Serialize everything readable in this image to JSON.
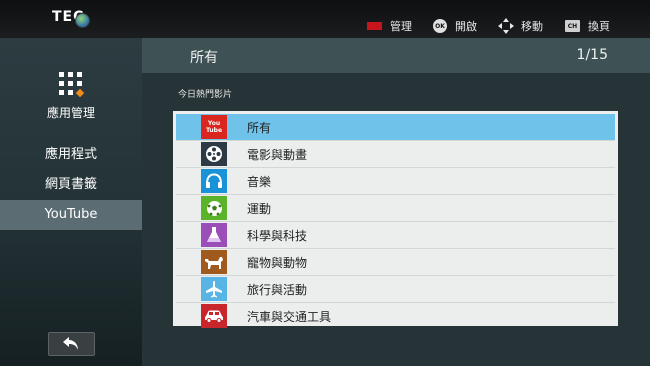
{
  "brand": {
    "logo_text": "TEC"
  },
  "hints": [
    {
      "key": "red",
      "label": "管理"
    },
    {
      "key": "ok",
      "key_text": "OK",
      "label": "開啟"
    },
    {
      "key": "move",
      "label": "移動"
    },
    {
      "key": "ch",
      "key_text": "CH",
      "label": "換頁"
    }
  ],
  "sidebar": {
    "title": "應用管理",
    "items": [
      {
        "label": "應用程式"
      },
      {
        "label": "網頁書籤"
      },
      {
        "label": "YouTube",
        "active": true
      }
    ]
  },
  "header": {
    "title": "所有",
    "page": "1/15"
  },
  "section_label": "今日熱門影片",
  "categories": [
    {
      "label": "所有",
      "icon": "youtube-icon",
      "icon_text": "You Tube",
      "color": "#d9261e",
      "selected": true
    },
    {
      "label": "電影與動畫",
      "icon": "film-reel-icon",
      "color": "#2d3a45"
    },
    {
      "label": "音樂",
      "icon": "headphones-icon",
      "color": "#1a92d8"
    },
    {
      "label": "運動",
      "icon": "soccer-ball-icon",
      "color": "#5bb32a"
    },
    {
      "label": "科學與科技",
      "icon": "flask-icon",
      "color": "#9a4fb8"
    },
    {
      "label": "寵物與動物",
      "icon": "dog-icon",
      "color": "#a05a1e"
    },
    {
      "label": "旅行與活動",
      "icon": "airplane-icon",
      "color": "#59b4e6"
    },
    {
      "label": "汽車與交通工具",
      "icon": "car-icon",
      "color": "#c8262a"
    }
  ],
  "colors": {
    "selected_row": "#6fc2ea",
    "active_sidebar": "#5b6d73",
    "header_bar": "#3e5256"
  }
}
